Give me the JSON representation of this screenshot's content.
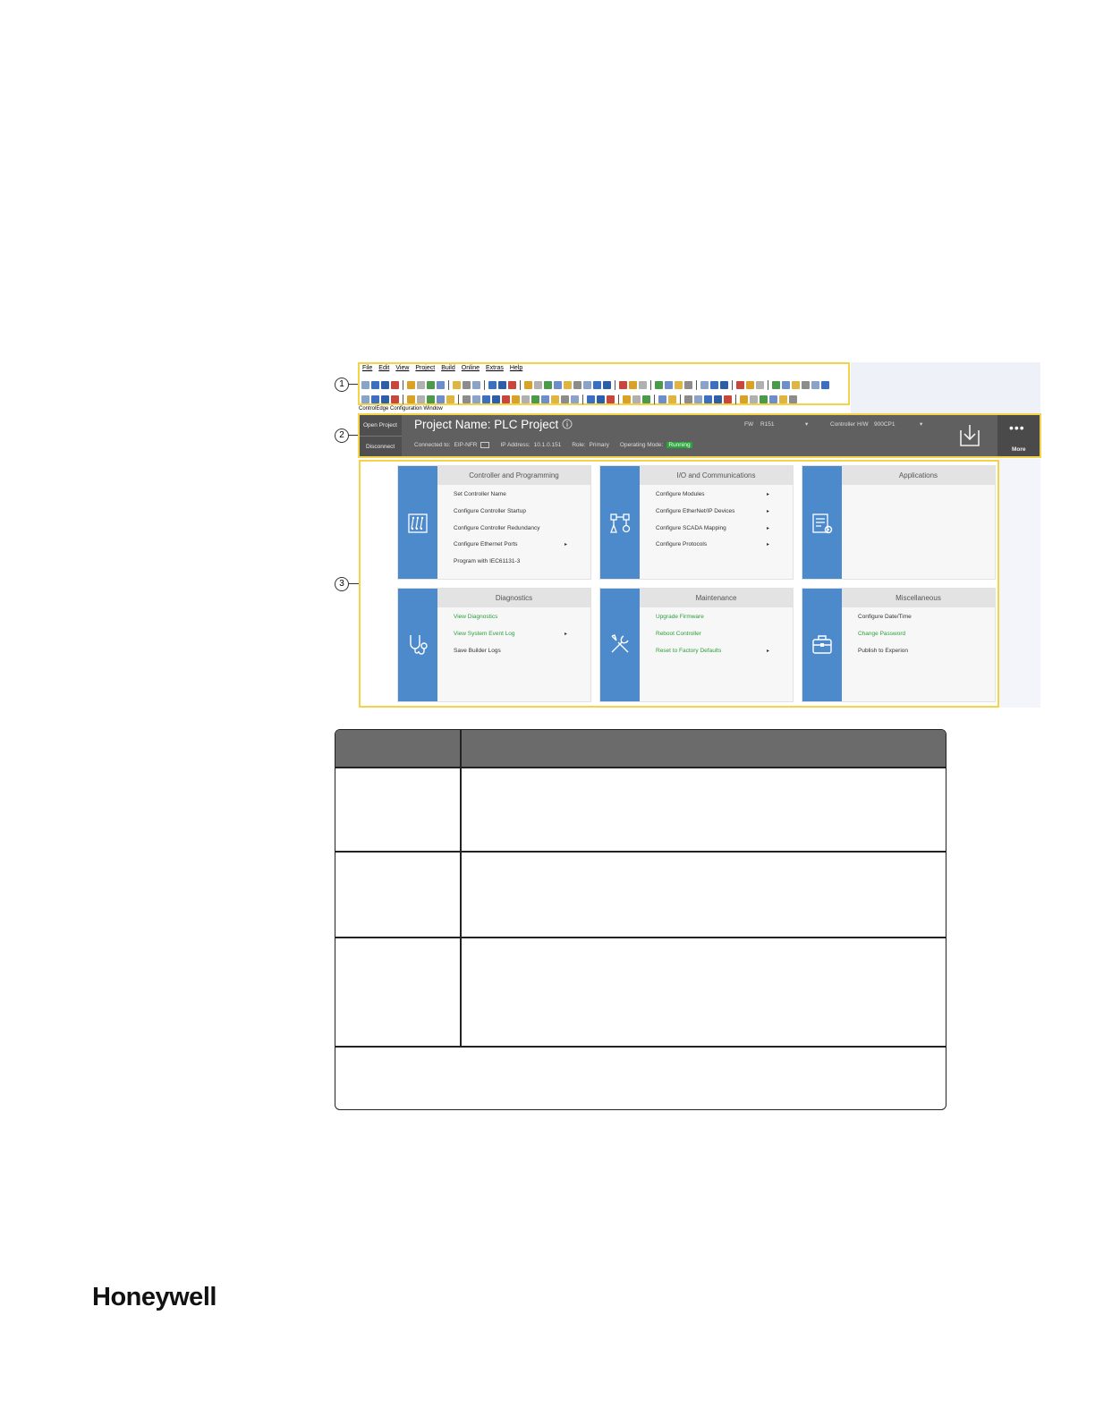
{
  "toolbar": {
    "menu": [
      "File",
      "Edit",
      "View",
      "Project",
      "Build",
      "Online",
      "Extras",
      "Help"
    ],
    "window_caption": "ControlEdge Configuration Window"
  },
  "callouts": [
    "1",
    "2",
    "3"
  ],
  "header": {
    "open_project": "Open Project",
    "disconnect": "Disconnect",
    "project_title": "Project Name: PLC Project",
    "fw_label": "FW",
    "fw_value": "R151",
    "hw_label": "Controller H/W",
    "hw_value": "900CP1",
    "connected_label": "Connected to:",
    "connected_value": "EIP-NFR",
    "ip_label": "IP Address:",
    "ip_value": "10.1.0.151",
    "role_label": "Role:",
    "role_value": "Primary",
    "mode_label": "Operating Mode:",
    "mode_value": "Running",
    "more_label": "More"
  },
  "tiles": [
    {
      "title": "Controller and Programming",
      "icon": "program-icon",
      "items": [
        {
          "label": "Set Controller Name",
          "arrow": false,
          "green": false
        },
        {
          "label": "Configure Controller Startup",
          "arrow": false,
          "green": false
        },
        {
          "label": "Configure Controller Redundancy",
          "arrow": false,
          "green": false
        },
        {
          "label": "Configure Ethernet Ports",
          "arrow": true,
          "green": false
        },
        {
          "label": "Program with IEC61131-3",
          "arrow": false,
          "green": false
        }
      ]
    },
    {
      "title": "I/O and Communications",
      "icon": "network-icon",
      "items": [
        {
          "label": "Configure Modules",
          "arrow": true,
          "green": false
        },
        {
          "label": "Configure EtherNet/IP Devices",
          "arrow": true,
          "green": false
        },
        {
          "label": "Configure SCADA Mapping",
          "arrow": true,
          "green": false
        },
        {
          "label": "Configure Protocols",
          "arrow": true,
          "green": false
        }
      ]
    },
    {
      "title": "Applications",
      "icon": "applications-icon",
      "items": []
    },
    {
      "title": "Diagnostics",
      "icon": "stethoscope-icon",
      "items": [
        {
          "label": "View Diagnostics",
          "arrow": false,
          "green": true
        },
        {
          "label": "View System Event Log",
          "arrow": true,
          "green": true
        },
        {
          "label": "Save Builder Logs",
          "arrow": false,
          "green": false
        }
      ]
    },
    {
      "title": "Maintenance",
      "icon": "tools-icon",
      "items": [
        {
          "label": "Upgrade Firmware",
          "arrow": false,
          "green": true
        },
        {
          "label": "Reboot Controller",
          "arrow": false,
          "green": true
        },
        {
          "label": "Reset to Factory Defaults",
          "arrow": true,
          "green": true
        }
      ]
    },
    {
      "title": "Miscellaneous",
      "icon": "briefcase-icon",
      "items": [
        {
          "label": "Configure Date/Time",
          "arrow": false,
          "green": false
        },
        {
          "label": "Change Password",
          "arrow": false,
          "green": true
        },
        {
          "label": "Publish to Experion",
          "arrow": false,
          "green": false
        }
      ]
    }
  ],
  "footer": {
    "logo": "Honeywell"
  },
  "colors": {
    "accent_yellow": "#f3d34a",
    "tile_blue": "#4c8acb",
    "header_gray": "#606060",
    "green_link": "#2aa13a"
  }
}
